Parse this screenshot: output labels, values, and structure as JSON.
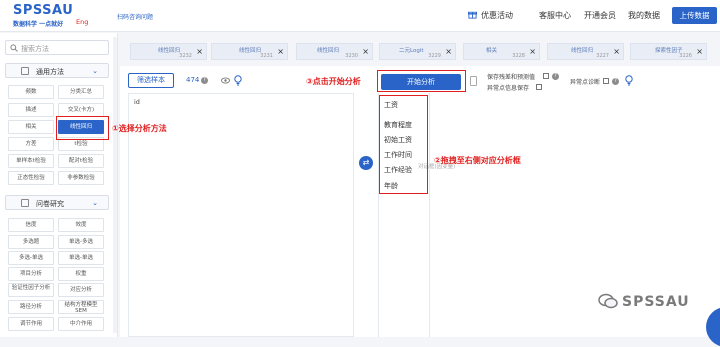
{
  "header": {
    "logo": "SPSSAU",
    "slogan": "数据科学 一点就好",
    "eng": "Eng",
    "feedback_link": "扫码咨询问题",
    "nav": [
      "优惠活动",
      "客服中心",
      "开通会员",
      "我的数据"
    ],
    "upload": "上传数据"
  },
  "sidebar": {
    "search_placeholder": "搜索方法",
    "section1": "通用方法",
    "section2": "问卷研究",
    "general_methods": [
      "频数",
      "分类汇总",
      "描述",
      "交叉(卡方)",
      "相关",
      "线性回归",
      "方差",
      "t检验",
      "单样本t检验",
      "配对t检验",
      "正态性检验",
      "非参数检验"
    ],
    "survey_methods": [
      "信度",
      "效度",
      "多选题",
      "单选-多选",
      "多选-单选",
      "单选-单选",
      "项目分析",
      "权重",
      "验证性因子分析",
      "对应分析",
      "路径分析",
      "结构方程模型SEM",
      "调节作用",
      "中介作用"
    ]
  },
  "annotations": {
    "step1": "①选择分析方法",
    "step2": "②拖拽至右侧对应分析框",
    "step3": "③点击开始分析"
  },
  "tabs": [
    {
      "name": "线性回归",
      "num": "3232"
    },
    {
      "name": "线性回归",
      "num": "3231"
    },
    {
      "name": "线性回归",
      "num": "3230"
    },
    {
      "name": "二元Logit",
      "num": "3229"
    },
    {
      "name": "相关",
      "num": "3228"
    },
    {
      "name": "线性回归",
      "num": "3227"
    },
    {
      "name": "探索性因子",
      "num": "3226"
    }
  ],
  "main": {
    "filter_button": "筛选样本",
    "count": "474",
    "id_label": "id",
    "analyze_button": "开始分析",
    "option_save_residual": "保存残差和预测值",
    "option_outlier": "异常点诊断",
    "option_save_outlier": "异常点信息保存",
    "placeholder": "对话框(因变量)",
    "variables": [
      "工资",
      "教育程度",
      "初始工资",
      "工作时间",
      "工作经验",
      "年龄"
    ]
  },
  "watermark": "SPSSAU",
  "colors": {
    "accent": "#2a64c8",
    "annotation": "#e02020"
  }
}
